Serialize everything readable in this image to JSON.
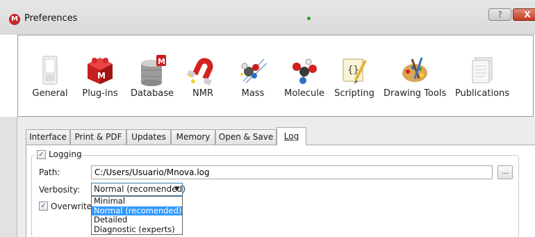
{
  "window": {
    "title": "Preferences",
    "help_glyph": "?",
    "close_glyph": "X"
  },
  "categories": [
    {
      "label": "General",
      "icon": "switch-icon"
    },
    {
      "label": "Plug-ins",
      "icon": "plugin-cube-icon"
    },
    {
      "label": "Database",
      "icon": "database-icon"
    },
    {
      "label": "NMR",
      "icon": "magnet-icon"
    },
    {
      "label": "Mass",
      "icon": "mass-spec-icon"
    },
    {
      "label": "Molecule",
      "icon": "molecule-icon"
    },
    {
      "label": "Scripting",
      "icon": "script-scroll-icon"
    },
    {
      "label": "Drawing Tools",
      "icon": "palette-icon"
    },
    {
      "label": "Publications",
      "icon": "documents-icon"
    }
  ],
  "tabs": [
    {
      "label": "Interface"
    },
    {
      "label": "Print & PDF"
    },
    {
      "label": "Updates"
    },
    {
      "label": "Memory"
    },
    {
      "label": "Open & Save"
    },
    {
      "label": "Log",
      "active": true
    }
  ],
  "log": {
    "logging_label": "Logging",
    "logging_checked": true,
    "path_label": "Path:",
    "path_value": "C:/Users/Usuario/Mnova.log",
    "browse_label": "...",
    "verbosity_label": "Verbosity:",
    "verbosity_selected": "Normal (recomended)",
    "verbosity_options": [
      "Minimal",
      "Normal (recomended)",
      "Detailed",
      "Diagnostic (experts)"
    ],
    "highlighted_option_index": 1,
    "overwrite_label": "Overwrite",
    "overwrite_checked": true
  },
  "colors": {
    "selection": "#3399ff",
    "close_button": "#c23a25",
    "app_icon": "#c8262b"
  }
}
